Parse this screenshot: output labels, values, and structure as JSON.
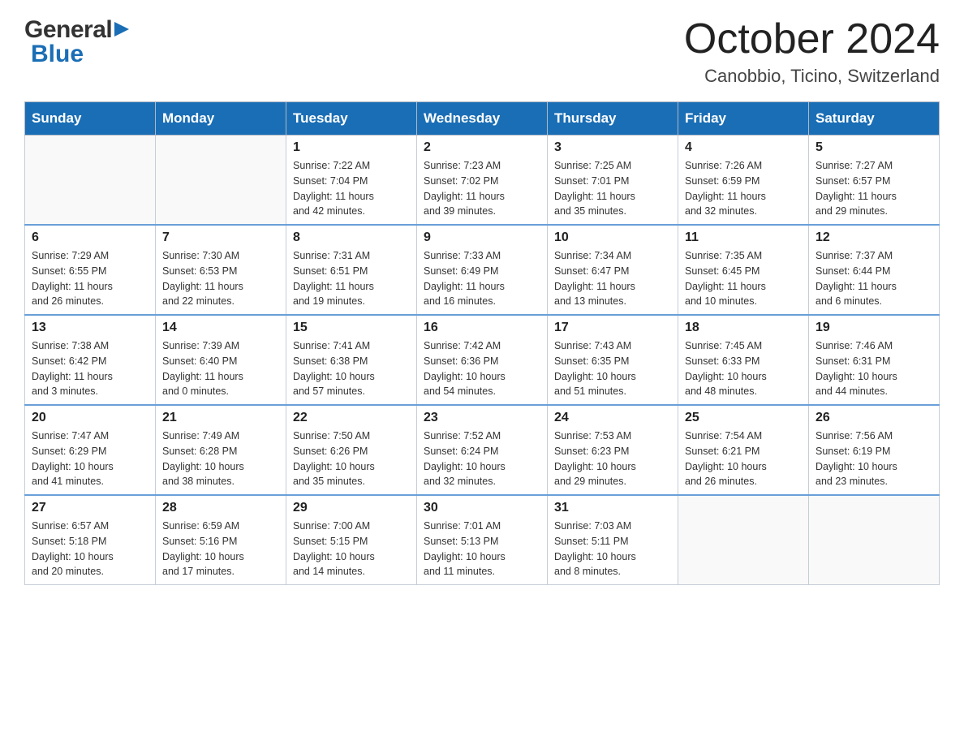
{
  "header": {
    "logo": {
      "general": "General",
      "blue": "Blue"
    },
    "title": "October 2024",
    "location": "Canobbio, Ticino, Switzerland"
  },
  "days_of_week": [
    "Sunday",
    "Monday",
    "Tuesday",
    "Wednesday",
    "Thursday",
    "Friday",
    "Saturday"
  ],
  "weeks": [
    [
      {
        "day": "",
        "info": ""
      },
      {
        "day": "",
        "info": ""
      },
      {
        "day": "1",
        "info": "Sunrise: 7:22 AM\nSunset: 7:04 PM\nDaylight: 11 hours\nand 42 minutes."
      },
      {
        "day": "2",
        "info": "Sunrise: 7:23 AM\nSunset: 7:02 PM\nDaylight: 11 hours\nand 39 minutes."
      },
      {
        "day": "3",
        "info": "Sunrise: 7:25 AM\nSunset: 7:01 PM\nDaylight: 11 hours\nand 35 minutes."
      },
      {
        "day": "4",
        "info": "Sunrise: 7:26 AM\nSunset: 6:59 PM\nDaylight: 11 hours\nand 32 minutes."
      },
      {
        "day": "5",
        "info": "Sunrise: 7:27 AM\nSunset: 6:57 PM\nDaylight: 11 hours\nand 29 minutes."
      }
    ],
    [
      {
        "day": "6",
        "info": "Sunrise: 7:29 AM\nSunset: 6:55 PM\nDaylight: 11 hours\nand 26 minutes."
      },
      {
        "day": "7",
        "info": "Sunrise: 7:30 AM\nSunset: 6:53 PM\nDaylight: 11 hours\nand 22 minutes."
      },
      {
        "day": "8",
        "info": "Sunrise: 7:31 AM\nSunset: 6:51 PM\nDaylight: 11 hours\nand 19 minutes."
      },
      {
        "day": "9",
        "info": "Sunrise: 7:33 AM\nSunset: 6:49 PM\nDaylight: 11 hours\nand 16 minutes."
      },
      {
        "day": "10",
        "info": "Sunrise: 7:34 AM\nSunset: 6:47 PM\nDaylight: 11 hours\nand 13 minutes."
      },
      {
        "day": "11",
        "info": "Sunrise: 7:35 AM\nSunset: 6:45 PM\nDaylight: 11 hours\nand 10 minutes."
      },
      {
        "day": "12",
        "info": "Sunrise: 7:37 AM\nSunset: 6:44 PM\nDaylight: 11 hours\nand 6 minutes."
      }
    ],
    [
      {
        "day": "13",
        "info": "Sunrise: 7:38 AM\nSunset: 6:42 PM\nDaylight: 11 hours\nand 3 minutes."
      },
      {
        "day": "14",
        "info": "Sunrise: 7:39 AM\nSunset: 6:40 PM\nDaylight: 11 hours\nand 0 minutes."
      },
      {
        "day": "15",
        "info": "Sunrise: 7:41 AM\nSunset: 6:38 PM\nDaylight: 10 hours\nand 57 minutes."
      },
      {
        "day": "16",
        "info": "Sunrise: 7:42 AM\nSunset: 6:36 PM\nDaylight: 10 hours\nand 54 minutes."
      },
      {
        "day": "17",
        "info": "Sunrise: 7:43 AM\nSunset: 6:35 PM\nDaylight: 10 hours\nand 51 minutes."
      },
      {
        "day": "18",
        "info": "Sunrise: 7:45 AM\nSunset: 6:33 PM\nDaylight: 10 hours\nand 48 minutes."
      },
      {
        "day": "19",
        "info": "Sunrise: 7:46 AM\nSunset: 6:31 PM\nDaylight: 10 hours\nand 44 minutes."
      }
    ],
    [
      {
        "day": "20",
        "info": "Sunrise: 7:47 AM\nSunset: 6:29 PM\nDaylight: 10 hours\nand 41 minutes."
      },
      {
        "day": "21",
        "info": "Sunrise: 7:49 AM\nSunset: 6:28 PM\nDaylight: 10 hours\nand 38 minutes."
      },
      {
        "day": "22",
        "info": "Sunrise: 7:50 AM\nSunset: 6:26 PM\nDaylight: 10 hours\nand 35 minutes."
      },
      {
        "day": "23",
        "info": "Sunrise: 7:52 AM\nSunset: 6:24 PM\nDaylight: 10 hours\nand 32 minutes."
      },
      {
        "day": "24",
        "info": "Sunrise: 7:53 AM\nSunset: 6:23 PM\nDaylight: 10 hours\nand 29 minutes."
      },
      {
        "day": "25",
        "info": "Sunrise: 7:54 AM\nSunset: 6:21 PM\nDaylight: 10 hours\nand 26 minutes."
      },
      {
        "day": "26",
        "info": "Sunrise: 7:56 AM\nSunset: 6:19 PM\nDaylight: 10 hours\nand 23 minutes."
      }
    ],
    [
      {
        "day": "27",
        "info": "Sunrise: 6:57 AM\nSunset: 5:18 PM\nDaylight: 10 hours\nand 20 minutes."
      },
      {
        "day": "28",
        "info": "Sunrise: 6:59 AM\nSunset: 5:16 PM\nDaylight: 10 hours\nand 17 minutes."
      },
      {
        "day": "29",
        "info": "Sunrise: 7:00 AM\nSunset: 5:15 PM\nDaylight: 10 hours\nand 14 minutes."
      },
      {
        "day": "30",
        "info": "Sunrise: 7:01 AM\nSunset: 5:13 PM\nDaylight: 10 hours\nand 11 minutes."
      },
      {
        "day": "31",
        "info": "Sunrise: 7:03 AM\nSunset: 5:11 PM\nDaylight: 10 hours\nand 8 minutes."
      },
      {
        "day": "",
        "info": ""
      },
      {
        "day": "",
        "info": ""
      }
    ]
  ]
}
